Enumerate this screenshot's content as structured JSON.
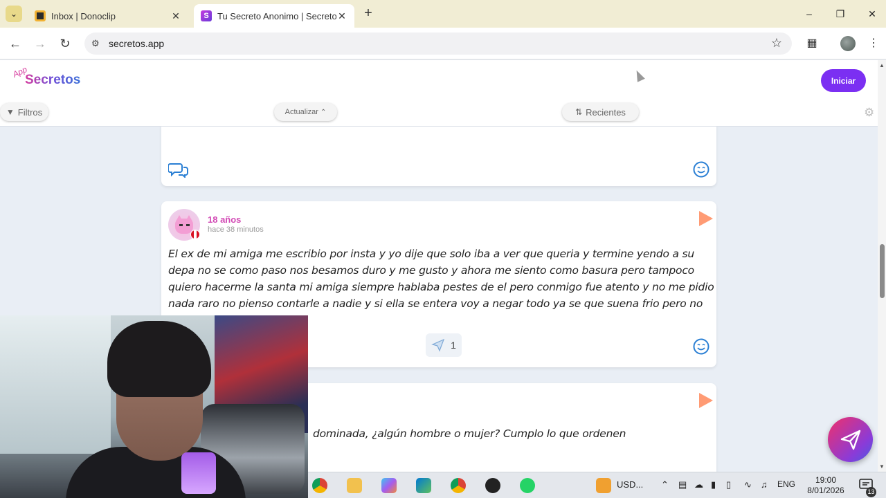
{
  "browser": {
    "tabs": [
      {
        "title": "Inbox | Donoclip",
        "active": false
      },
      {
        "title": "Tu Secreto Anonimo | Secretos",
        "active": true
      }
    ],
    "new_tab_label": "+",
    "url": "secretos.app"
  },
  "site": {
    "logo_small": "App",
    "logo": "Secretos",
    "login_button": "Iniciar",
    "filters_label": "Filtros",
    "refresh_label": "Actualizar",
    "sort_label": "Recientes"
  },
  "posts": [
    {
      "id": "post-1",
      "age": "18 años",
      "time": "hace 38 minutos",
      "text": "El ex de mi amiga me escribio por insta y yo dije que solo iba a ver que queria y termine yendo a su depa no se como paso nos besamos duro y me gusto y ahora me siento como basura pero tampoco quiero hacerme la santa mi amiga siempre hablaba pestes de el pero conmigo fue atento y no me pidio nada raro no pienso contarle a nadie y si ella se entera voy a negar todo ya se que suena frio pero no me arrepiento listo",
      "likes": "1"
    },
    {
      "id": "post-2",
      "text_visible": "dominada, ¿algún hombre o mujer? Cumplo lo que ordenen"
    }
  ],
  "taskbar": {
    "currency": "USD...",
    "language": "ENG",
    "time": "19:00",
    "date": "8/01/2026",
    "notifications": "13"
  },
  "colors": {
    "accent": "#7b2ff2",
    "age_pink": "#d24ab5",
    "report_orange": "#ff9b74",
    "icon_blue": "#2a7fd4"
  }
}
